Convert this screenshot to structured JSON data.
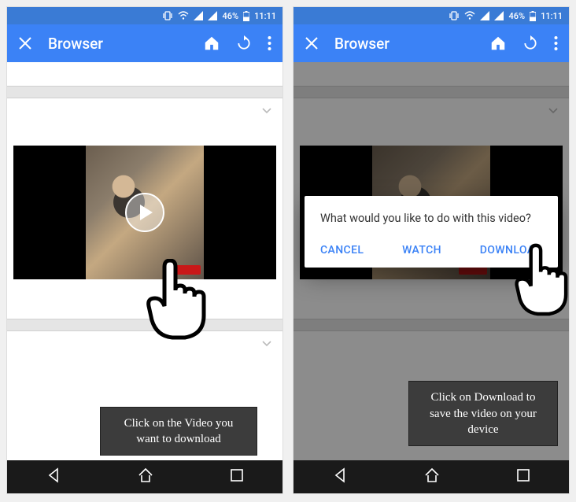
{
  "status": {
    "battery": "46%",
    "time": "11:11"
  },
  "appbar": {
    "title": "Browser"
  },
  "dialog": {
    "title": "What would you like to do with this video?",
    "cancel": "CANCEL",
    "watch": "WATCH",
    "download": "DOWNLOAD"
  },
  "callouts": {
    "left": "Click on the Video you want to download",
    "right": "Click on Download to save the video on your device"
  }
}
